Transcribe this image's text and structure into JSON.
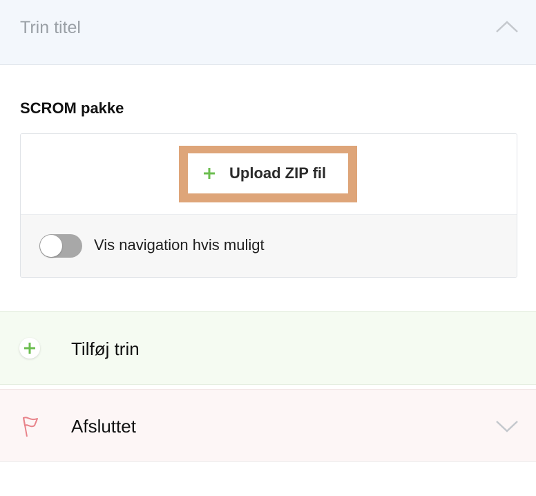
{
  "step": {
    "title_placeholder": "Trin titel",
    "collapse_icon": "chevron-up-icon"
  },
  "scorm": {
    "section_label": "SCROM pakke",
    "upload_label": "Upload ZIP fil",
    "upload_icon": "plus-icon",
    "toggle_label": "Vis navigation hvis muligt",
    "toggle_on": false
  },
  "add_step": {
    "label": "Tilføj trin",
    "icon": "plus-icon"
  },
  "finished": {
    "label": "Afsluttet",
    "icon": "flag-icon",
    "expand_icon": "chevron-down-icon"
  },
  "colors": {
    "accent_green": "#6bbd4f",
    "flag_red": "#e8838a",
    "highlight": "#dea579"
  }
}
